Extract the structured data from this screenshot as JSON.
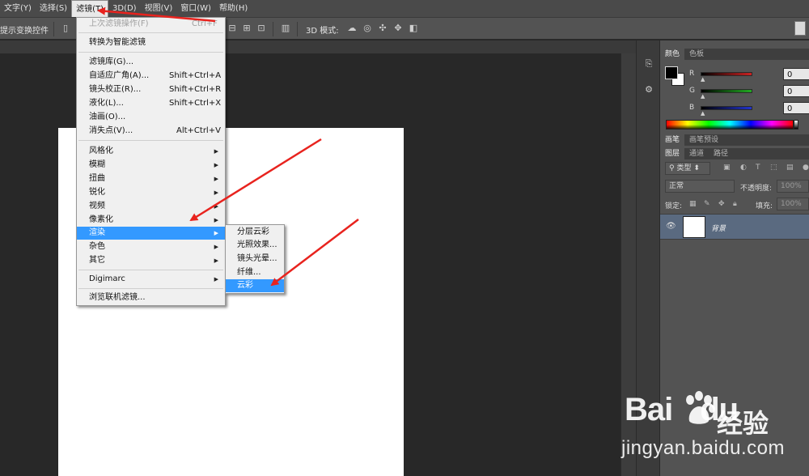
{
  "menubar": [
    {
      "label": "文字(Y)",
      "active": false
    },
    {
      "label": "选择(S)",
      "active": false
    },
    {
      "label": "滤镜(T)",
      "active": true
    },
    {
      "label": "3D(D)",
      "active": false
    },
    {
      "label": "视图(V)",
      "active": false
    },
    {
      "label": "窗口(W)",
      "active": false
    },
    {
      "label": "帮助(H)",
      "active": false
    }
  ],
  "optbar": {
    "show_transform": "提示变换控件",
    "mode_3d": "3D 模式:"
  },
  "filter_menu": {
    "items": [
      {
        "label": "上次滤镜操作(F)",
        "shortcut": "Ctrl+F",
        "disabled": true
      },
      {
        "label": "转换为智能滤镜",
        "shortcut": ""
      },
      {
        "label": "滤镜库(G)...",
        "shortcut": ""
      },
      {
        "label": "自适应广角(A)...",
        "shortcut": "Shift+Ctrl+A"
      },
      {
        "label": "镜头校正(R)...",
        "shortcut": "Shift+Ctrl+R"
      },
      {
        "label": "液化(L)...",
        "shortcut": "Shift+Ctrl+X"
      },
      {
        "label": "油画(O)...",
        "shortcut": ""
      },
      {
        "label": "消失点(V)...",
        "shortcut": "Alt+Ctrl+V"
      },
      {
        "label": "风格化",
        "submenu": true
      },
      {
        "label": "模糊",
        "submenu": true
      },
      {
        "label": "扭曲",
        "submenu": true
      },
      {
        "label": "锐化",
        "submenu": true
      },
      {
        "label": "视频",
        "submenu": true
      },
      {
        "label": "像素化",
        "submenu": true
      },
      {
        "label": "渲染",
        "submenu": true,
        "highlighted": true
      },
      {
        "label": "杂色",
        "submenu": true
      },
      {
        "label": "其它",
        "submenu": true
      },
      {
        "label": "Digimarc",
        "submenu": true
      },
      {
        "label": "浏览联机滤镜...",
        "shortcut": ""
      }
    ]
  },
  "render_submenu": {
    "items": [
      {
        "label": "分层云彩"
      },
      {
        "label": "光照效果..."
      },
      {
        "label": "镜头光晕..."
      },
      {
        "label": "纤维..."
      },
      {
        "label": "云彩",
        "highlighted": true
      }
    ]
  },
  "color_panel": {
    "tabs": [
      "颜色",
      "色板"
    ],
    "channels": [
      {
        "name": "R",
        "value": "0",
        "color": "#cc2222"
      },
      {
        "name": "G",
        "value": "0",
        "color": "#22aa22"
      },
      {
        "name": "B",
        "value": "0",
        "color": "#2233cc"
      }
    ]
  },
  "brush_panel": {
    "tabs": [
      "画笔",
      "画笔预设"
    ]
  },
  "layers_panel": {
    "tabs": [
      "图层",
      "通道",
      "路径"
    ],
    "filter_kind": "类型",
    "blend_mode": "正常",
    "opacity_label": "不透明度:",
    "opacity_value": "100%",
    "lock_label": "锁定:",
    "fill_label": "填充:",
    "fill_value": "100%",
    "layers": [
      {
        "name": "背景"
      }
    ]
  },
  "watermark": {
    "logo": "Bai",
    "logo_du": "du",
    "brand_cn": "经验",
    "url": "jingyan.baidu.com"
  },
  "colors": {
    "menu_highlight": "#3399ff",
    "arrow": "#e8231e",
    "layer_selected": "#5a6a80"
  }
}
